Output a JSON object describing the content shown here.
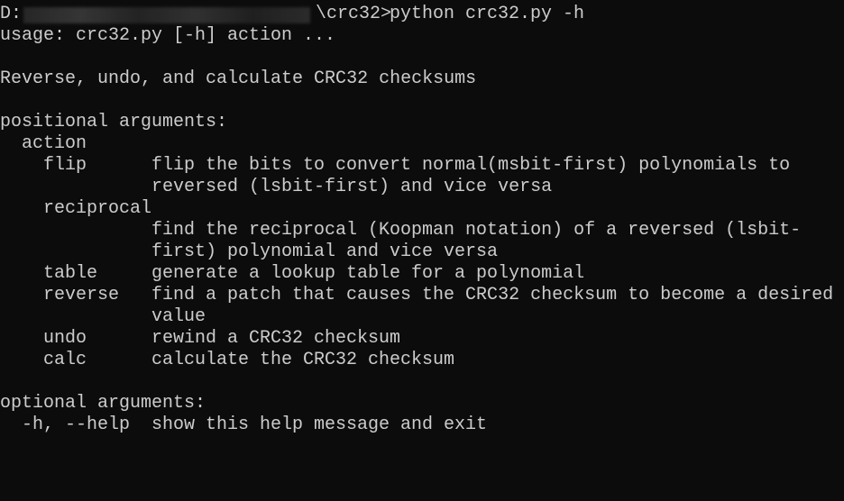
{
  "prompt": {
    "drive": "D:",
    "path_tail": "\\crc32>",
    "command": "python crc32.py -h"
  },
  "usage": "usage: crc32.py [-h] action ...",
  "description": "Reverse, undo, and calculate CRC32 checksums",
  "positional": {
    "heading": "positional arguments:",
    "group": "action",
    "items": [
      {
        "name": "flip",
        "help1": "flip the bits to convert normal(msbit-first) polynomials to",
        "help2": "reversed (lsbit-first) and vice versa"
      },
      {
        "name": "reciprocal",
        "help1": "find the reciprocal (Koopman notation) of a reversed (lsbit-",
        "help2": "first) polynomial and vice versa"
      },
      {
        "name": "table",
        "help1": "generate a lookup table for a polynomial"
      },
      {
        "name": "reverse",
        "help1": "find a patch that causes the CRC32 checksum to become a desired",
        "help2": "value"
      },
      {
        "name": "undo",
        "help1": "rewind a CRC32 checksum"
      },
      {
        "name": "calc",
        "help1": "calculate the CRC32 checksum"
      }
    ]
  },
  "optional": {
    "heading": "optional arguments:",
    "flag": "-h, --help",
    "help": "show this help message and exit"
  }
}
